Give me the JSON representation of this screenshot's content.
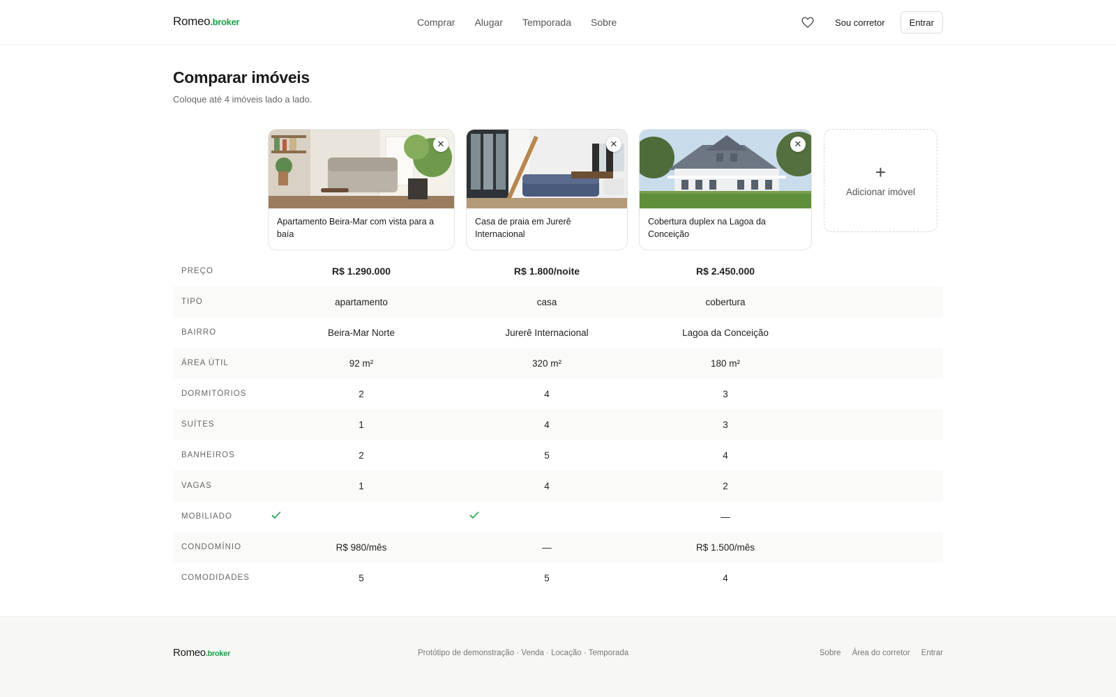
{
  "brand": {
    "name": "Romeo",
    "suffix": ".broker",
    "accent": "#1e9e4a"
  },
  "nav": {
    "items": [
      "Comprar",
      "Alugar",
      "Temporada",
      "Sobre"
    ],
    "favorites_icon": "heart-icon",
    "agent_link": "Sou corretor",
    "login_button": "Entrar"
  },
  "page": {
    "title": "Comparar imóveis",
    "subtitle": "Coloque até 4 imóveis lado a lado."
  },
  "properties": [
    {
      "name": "Apartamento Beira-Mar com vista para a baía",
      "close_icon": "close-icon"
    },
    {
      "name": "Casa de praia em Jurerê Internacional",
      "close_icon": "close-icon"
    },
    {
      "name": "Cobertura duplex na Lagoa da Conceição",
      "close_icon": "close-icon"
    }
  ],
  "add_card": {
    "icon": "plus-icon",
    "label": "Adicionar imóvel"
  },
  "comparison": {
    "rows": [
      {
        "label": "PREÇO",
        "values": [
          "R$ 1.290.000",
          "R$ 1.800/noite",
          "R$ 2.450.000"
        ]
      },
      {
        "label": "TIPO",
        "values": [
          "apartamento",
          "casa",
          "cobertura"
        ]
      },
      {
        "label": "BAIRRO",
        "values": [
          "Beira-Mar Norte",
          "Jurerê Internacional",
          "Lagoa da Conceição"
        ]
      },
      {
        "label": "ÁREA ÚTIL",
        "values": [
          "92 m²",
          "320 m²",
          "180 m²"
        ]
      },
      {
        "label": "DORMITÓRIOS",
        "values": [
          "2",
          "4",
          "3"
        ]
      },
      {
        "label": "SUÍTES",
        "values": [
          "1",
          "4",
          "3"
        ]
      },
      {
        "label": "BANHEIROS",
        "values": [
          "2",
          "5",
          "4"
        ]
      },
      {
        "label": "VAGAS",
        "values": [
          "1",
          "4",
          "2"
        ]
      },
      {
        "label": "MOBILIADO",
        "values": [
          "check",
          "check",
          "—"
        ]
      },
      {
        "label": "CONDOMÍNIO",
        "values": [
          "R$ 980/mês",
          "—",
          "R$ 1.500/mês"
        ]
      },
      {
        "label": "COMODIDADES",
        "values": [
          "5",
          "5",
          "4"
        ]
      }
    ]
  },
  "footer": {
    "brand": "Romeo",
    "brand_suffix": ".broker",
    "tagline": "Protótipo de demonstração · Venda · Locação · Temporada",
    "links": [
      "Sobre",
      "Área do corretor",
      "Entrar"
    ]
  }
}
